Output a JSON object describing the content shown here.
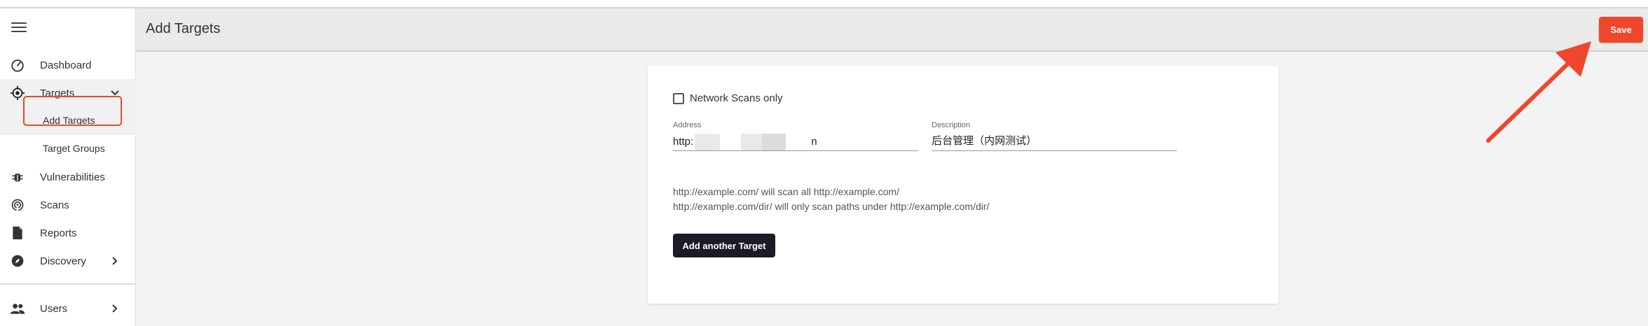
{
  "header": {
    "title": "Add Targets",
    "save_label": "Save"
  },
  "sidebar": {
    "items": [
      {
        "label": "Dashboard",
        "icon": "speedometer-icon"
      },
      {
        "label": "Targets",
        "icon": "crosshair-icon",
        "expanded": true
      },
      {
        "label": "Vulnerabilities",
        "icon": "bug-icon"
      },
      {
        "label": "Scans",
        "icon": "radar-icon"
      },
      {
        "label": "Reports",
        "icon": "document-icon"
      },
      {
        "label": "Discovery",
        "icon": "compass-icon"
      },
      {
        "label": "Users",
        "icon": "users-icon"
      }
    ],
    "subitems": [
      {
        "label": "Add Targets",
        "selected": true
      },
      {
        "label": "Target Groups"
      }
    ]
  },
  "form": {
    "network_scans_label": "Network Scans only",
    "network_scans_checked": false,
    "address_label": "Address",
    "address_prefix": "http:",
    "address_suffix": "n",
    "description_label": "Description",
    "description_value": "后台管理（内网测试）",
    "hint_line1": "http://example.com/ will scan all http://example.com/",
    "hint_line2": "http://example.com/dir/ will only scan paths under http://example.com/dir/",
    "add_another_label": "Add another Target"
  },
  "colors": {
    "accent": "#f0462b",
    "button_dark": "#1c1c28",
    "header_bg": "#eaeaea"
  }
}
